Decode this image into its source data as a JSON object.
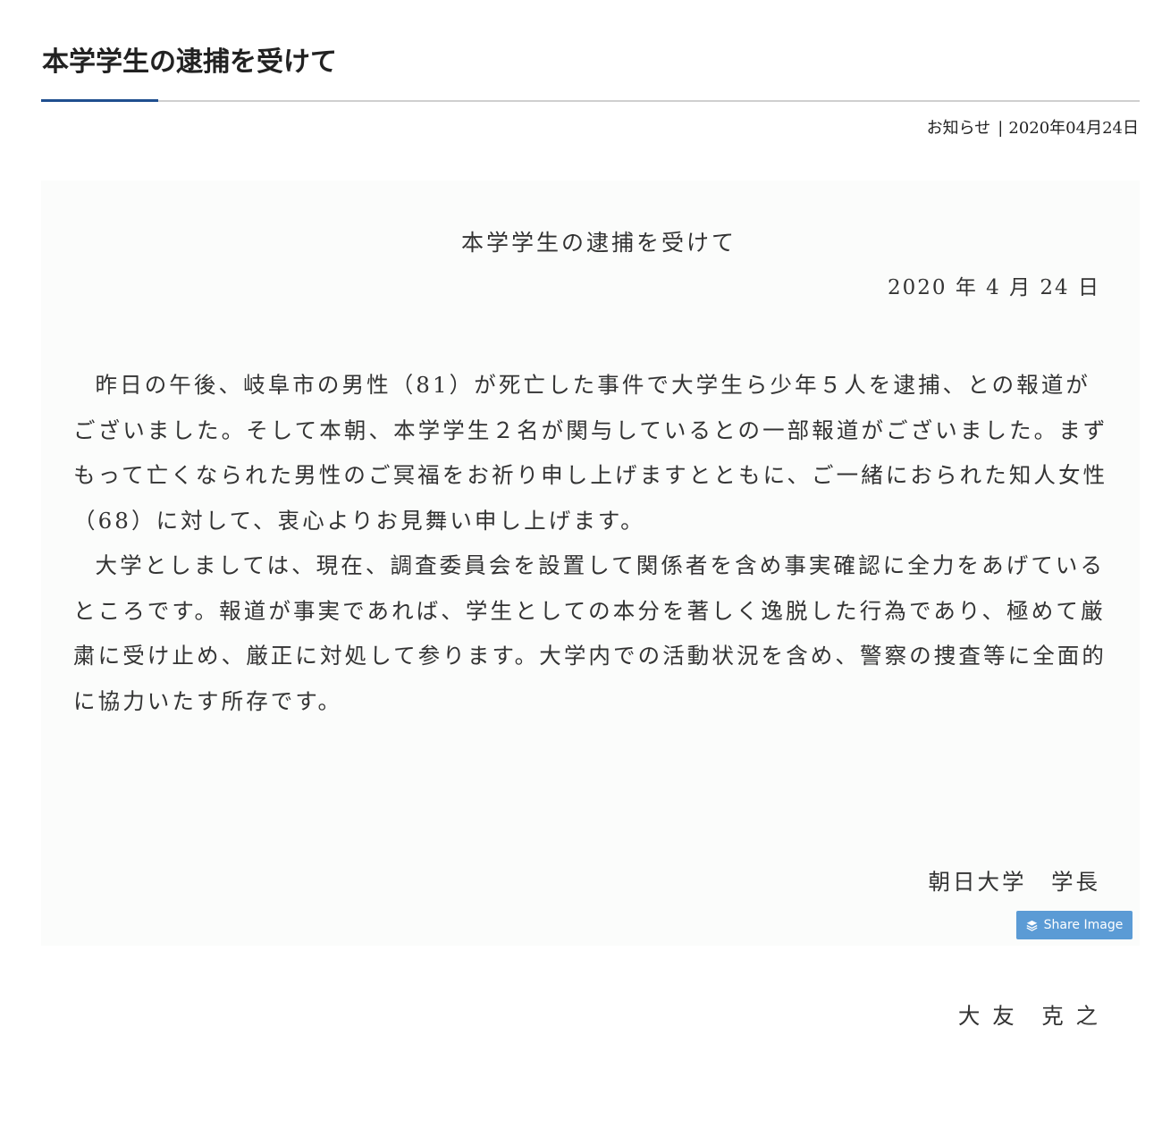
{
  "header": {
    "title": "本学学生の逮捕を受けて",
    "category": "お知らせ",
    "separator": "|",
    "date": "2020年04月24日"
  },
  "notice": {
    "title": "本学学生の逮捕を受けて",
    "date": "2020 年 4 月 24 日",
    "paragraphs": [
      "昨日の午後、岐阜市の男性（81）が死亡した事件で大学生ら少年５人を逮捕、との報道がございました。そして本朝、本学学生２名が関与しているとの一部報道がございました。まずもって亡くなられた男性のご冥福をお祈り申し上げますとともに、ご一緒におられた知人女性（68）に対して、衷心よりお見舞い申し上げます。",
      "大学としましては、現在、調査委員会を設置して関係者を含め事実確認に全力をあげているところです。報道が事実であれば、学生としての本分を著しく逸脱した行為であり、極めて厳粛に受け止め、厳正に対処して参ります。大学内での活動状況を含め、警察の捜査等に全面的に協力いたす所存です。"
    ],
    "signature": {
      "organization": "朝日大学　学長",
      "name": "大 友　克 之"
    }
  },
  "share_button": {
    "label": "Share Image",
    "icon": "layers-icon"
  },
  "colors": {
    "accent": "#1f4f8f",
    "rule": "#cfcfcf",
    "button": "#5b9bd5",
    "panel": "#fbfcfb"
  }
}
